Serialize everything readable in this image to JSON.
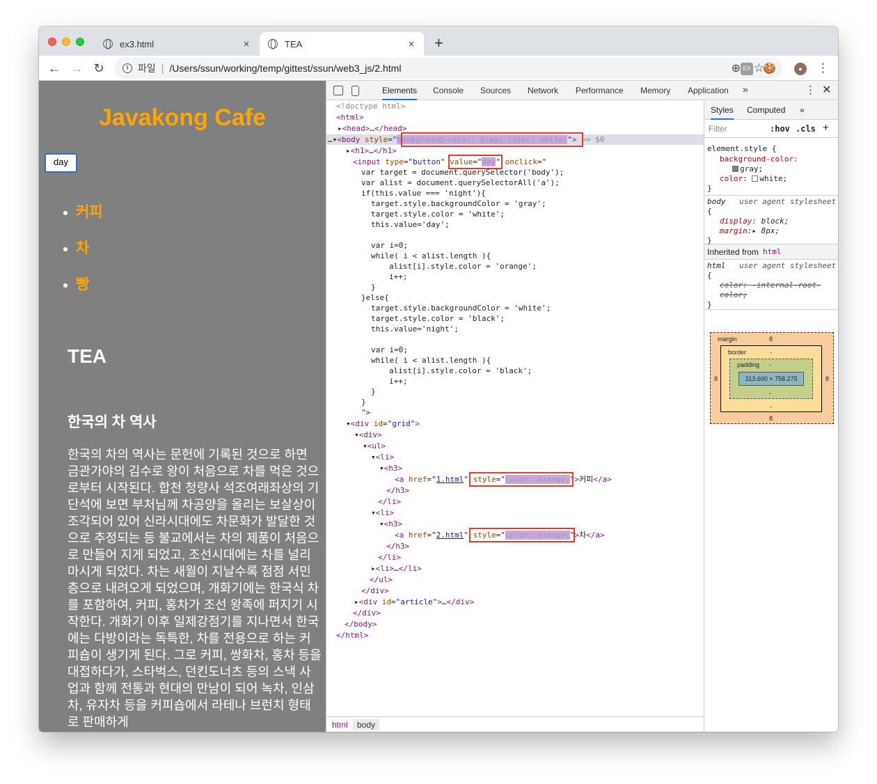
{
  "browser": {
    "tabs": [
      {
        "title": "ex3.html",
        "close": "×"
      },
      {
        "title": "TEA",
        "close": "×"
      }
    ],
    "new_tab": "+",
    "back": "←",
    "forward": "→",
    "reload": "↻",
    "url_scheme": "파일",
    "url_separator": "|",
    "url": "/Users/ssun/working/temp/gittest/ssun/web3_js/2.html",
    "zoom_icon": "⊕",
    "bookmark_star": "☆",
    "menu": "⋮"
  },
  "page": {
    "title": "Javakong Cafe",
    "button_value": "day",
    "menu": [
      "커피",
      "차",
      "빵"
    ],
    "heading": "TEA",
    "subheading": "한국의 차 역사",
    "body": "한국의 차의 역사는 문헌에 기록된 것으로 하면 금관가야의 김수로 왕이 처음으로 차를 먹은 것으로부터 시작된다. 합천 청량사 석조여래좌상의 기단석에 보면 부처님께 차공양을 올리는 보살상이 조각되어 있어 신라시대에도 차문화가 발달한 것으로 추정되는 등 불교에서는 차의 제품이 처음으로 만들어 지게 되었고, 조선시대에는 차를 널리 마시게 되었다. 차는 새월이 지날수록 점점 서민층으로 내려오게 되었으며, 개화기에는 한국식 차를 포함하여, 커피, 홍차가 조선 왕족에 퍼지기 시작한다. 개화기 이후 일제강점기를 지나면서 한국에는 다방이라는 독특한, 차를 전용으로 하는 커피숍이 생기게 된다. 그로 커피, 쌍화차, 홍차 등을 대접하다가, 스타벅스, 던킨도너츠 등의 스낵 사업과 함께 전통과 현대의 만남이 되어 녹차, 인삼차, 유자차 등을 커피숍에서 라테나 브런치 형태로 판매하게"
  },
  "devtools": {
    "tabs": [
      "Elements",
      "Console",
      "Sources",
      "Network",
      "Performance",
      "Memory",
      "Application"
    ],
    "more": "»",
    "kebab": "⋮",
    "close": "✕",
    "active_tab": "Elements",
    "breadcrumbs": [
      "html",
      "body"
    ],
    "styles_tabs": [
      "Styles",
      "Computed"
    ],
    "filter_placeholder": "Filter",
    "hov": ":hov",
    "cls": ".cls",
    "add": "+",
    "element_style_selector": "element.style {",
    "element_style_props": [
      {
        "name": "background-color",
        "value": "gray"
      },
      {
        "name": "color",
        "value": "white"
      }
    ],
    "body_rule_selector": "body",
    "ua_label": "user agent stylesheet",
    "body_props": [
      {
        "name": "display",
        "value": "block"
      },
      {
        "name": "margin",
        "value": "8px"
      }
    ],
    "inherited_label": "Inherited from",
    "inherited_from": "html",
    "html_rule_selector": "html",
    "html_prop": "color: -internal-root-color;",
    "box_model": {
      "margin_label": "margin",
      "margin": "8",
      "border_label": "border",
      "padding_label": "padding",
      "dash": "-",
      "content": "313.600 × 758.275"
    }
  },
  "colors": {
    "page_bg": "gray",
    "accent": "orange",
    "highlight_box": "#e8372c",
    "devtools_active": "#1a73e8"
  }
}
